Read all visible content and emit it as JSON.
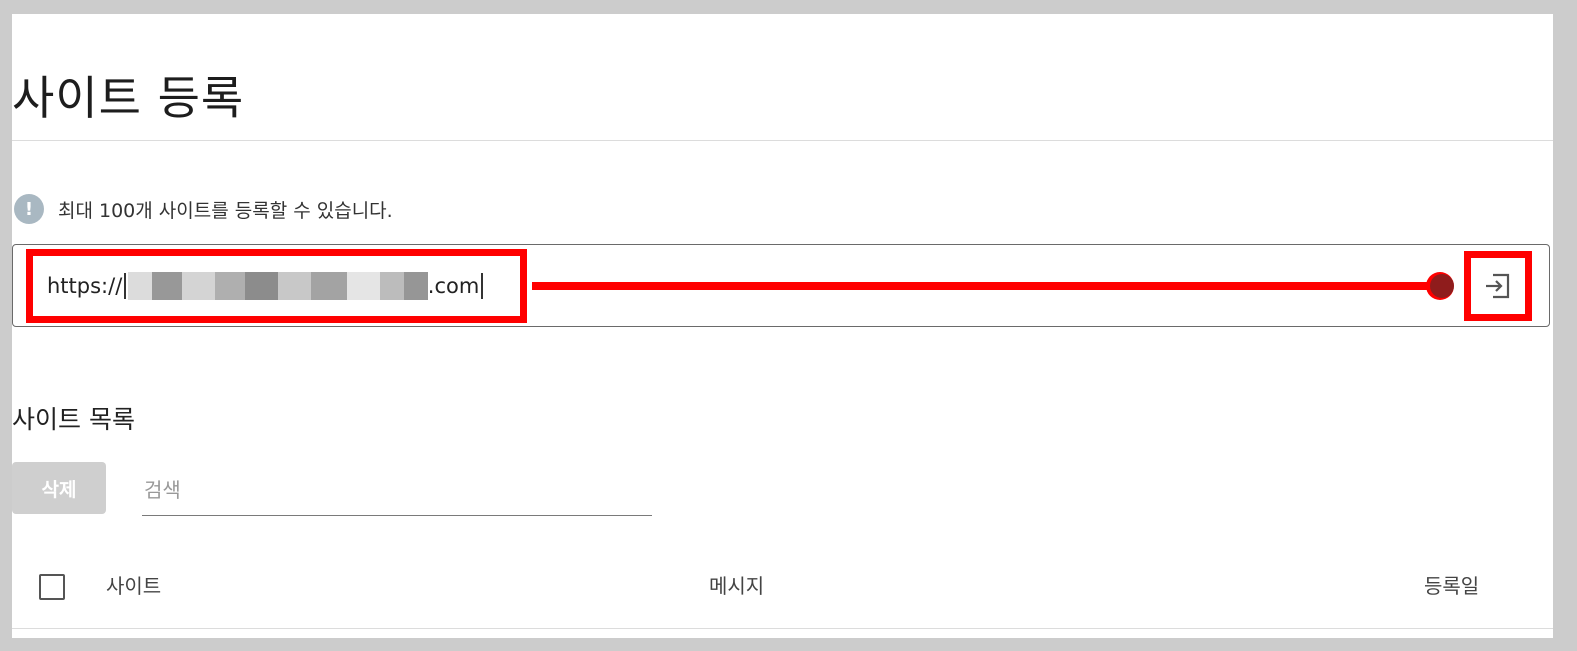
{
  "page": {
    "title": "사이트 등록"
  },
  "notice": {
    "icon": "info-icon",
    "icon_glyph": "!",
    "text": "최대 100개 사이트를 등록할 수 있습니다."
  },
  "url_input": {
    "prefix": "https://",
    "suffix": ".com",
    "highlight_color": "#ff0000"
  },
  "submit": {
    "icon": "login-arrow-icon"
  },
  "list": {
    "title": "사이트 목록",
    "delete_label": "삭제",
    "search_placeholder": "검색",
    "columns": {
      "site": "사이트",
      "message": "메시지",
      "date": "등록일"
    }
  },
  "colors": {
    "annotation": "#ff0000",
    "disabled_button": "#cfcfcf",
    "info_icon": "#a9b8c2"
  }
}
